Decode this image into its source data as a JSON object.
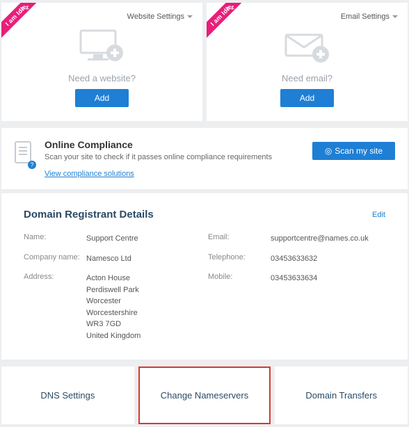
{
  "ribbon_text": "I am Idle",
  "website_card": {
    "settings_label": "Website Settings",
    "prompt": "Need a website?",
    "button": "Add"
  },
  "email_card": {
    "settings_label": "Email Settings",
    "prompt": "Need email?",
    "button": "Add"
  },
  "compliance": {
    "title": "Online Compliance",
    "subtitle": "Scan your site to check if it passes online compliance requirements",
    "link": "View compliance solutions",
    "scan_button": "Scan my site"
  },
  "registrant": {
    "heading": "Domain Registrant Details",
    "edit": "Edit",
    "labels": {
      "name": "Name:",
      "company": "Company name:",
      "address": "Address:",
      "email": "Email:",
      "telephone": "Telephone:",
      "mobile": "Mobile:"
    },
    "values": {
      "name": "Support Centre",
      "company": "Namesco Ltd",
      "address": "Acton House\nPerdiswell Park\nWorcester\nWorcestershire\nWR3 7GD\nUnited Kingdom",
      "email": "supportcentre@names.co.uk",
      "telephone": "03453633632",
      "mobile": "03453633634"
    }
  },
  "tiles": {
    "dns": "DNS Settings",
    "nameservers": "Change Nameservers",
    "transfers": "Domain Transfers"
  }
}
